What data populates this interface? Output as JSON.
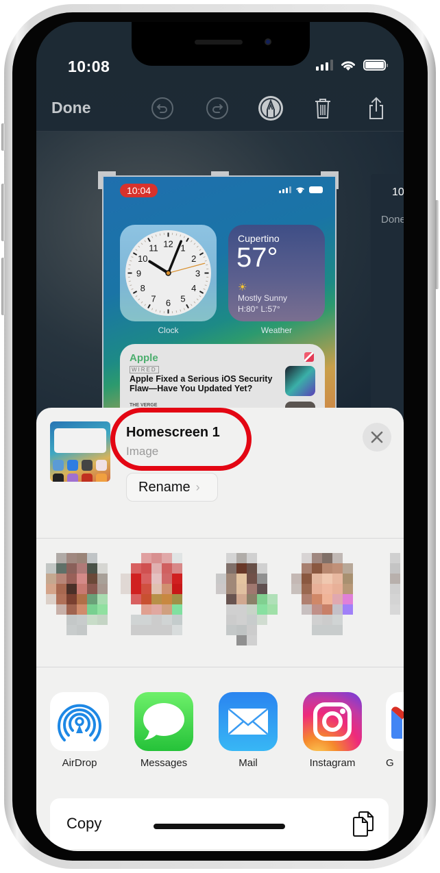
{
  "status_bar": {
    "time": "10:08",
    "signal_icon": "cellular-signal-icon",
    "wifi_icon": "wifi-icon",
    "battery_icon": "battery-icon"
  },
  "toolbar": {
    "done_label": "Done",
    "icons": [
      "undo-icon",
      "redo-icon",
      "markup-pen-icon",
      "trash-icon",
      "share-icon"
    ]
  },
  "screenshot_preview": {
    "time_pill": "10:04",
    "clock_widget": {
      "label": "Clock",
      "numbers": [
        "12",
        "1",
        "2",
        "3",
        "4",
        "5",
        "6",
        "7",
        "8",
        "9",
        "10",
        "11"
      ]
    },
    "weather_widget": {
      "label": "Weather",
      "city": "Cupertino",
      "temp": "57°",
      "condition": "Mostly Sunny",
      "high_low": "H:80° L:57°"
    },
    "news_widget": {
      "source": "Apple",
      "publisher": "WIRED",
      "headline": "Apple Fixed a Serious iOS Security Flaw—Have You Updated Yet?",
      "publisher2": "THE VERGE"
    }
  },
  "next_page_preview": {
    "time": "10",
    "done_label": "Done"
  },
  "share_sheet": {
    "file_name": "Homescreen 1",
    "file_type": "Image",
    "rename_label": "Rename",
    "rename_chevron": "›",
    "close_icon": "close-icon",
    "annotation_color": "#e30613",
    "apps": [
      {
        "label": "AirDrop",
        "icon": "airdrop-icon"
      },
      {
        "label": "Messages",
        "icon": "messages-icon"
      },
      {
        "label": "Mail",
        "icon": "mail-icon"
      },
      {
        "label": "Instagram",
        "icon": "instagram-icon"
      },
      {
        "label": "G",
        "icon": "gmail-icon"
      }
    ],
    "actions": [
      {
        "label": "Copy",
        "icon": "copy-icon"
      }
    ]
  }
}
